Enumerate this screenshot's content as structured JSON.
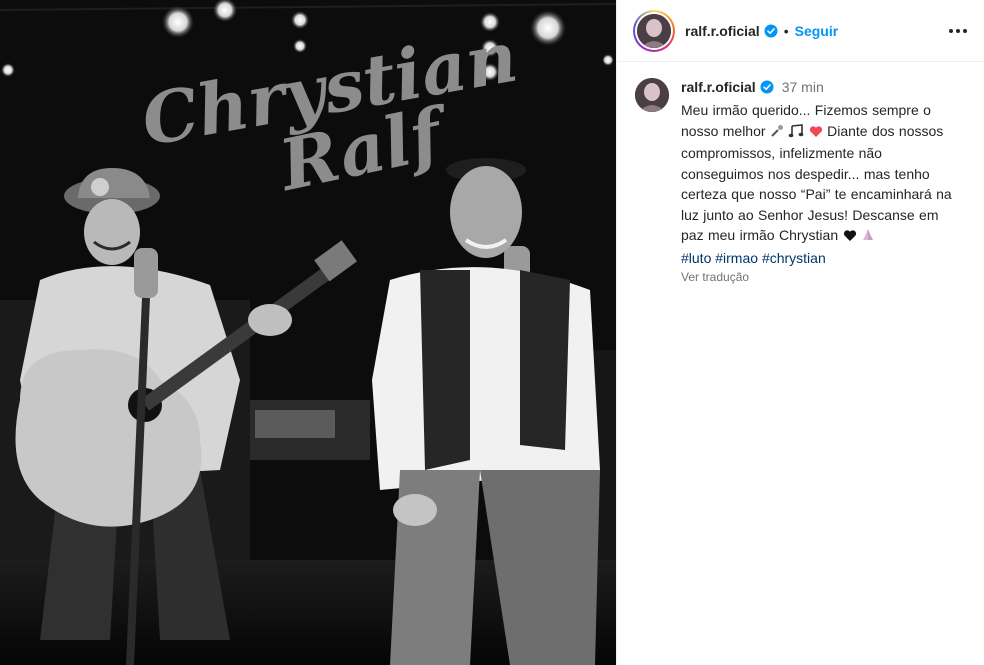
{
  "photo": {
    "sign_line1": "Chrystian",
    "sign_line2": "Ralf"
  },
  "header": {
    "username": "ralf.r.oficial",
    "separator": "•",
    "follow_label": "Seguir",
    "more_label": "•••"
  },
  "post": {
    "username": "ralf.r.oficial",
    "time": "37 min",
    "caption_before_icons": "Meu irmão querido... Fizemos sempre o nosso melhor ",
    "caption_after_icons": " Diante dos nossos compromissos, infelizmente não conseguimos nos despedir... mas tenho certeza que nosso “Pai” te encaminhará na luz junto ao Senhor Jesus! Descanse em paz meu irmão Chrystian ",
    "hashtags": [
      "#luto",
      "#irmao",
      "#chrystian"
    ],
    "translate_label": "Ver tradução"
  },
  "icons": {
    "verified": "verified-badge-icon",
    "caption_icons": [
      "microphone-icon",
      "music-notes-icon",
      "red-heart-icon",
      "black-heart-icon",
      "praying-hands-icon"
    ]
  },
  "colors": {
    "link_blue": "#0095f6",
    "hashtag": "#00376b",
    "meta_gray": "#737373",
    "heart_red": "#ed4956"
  }
}
